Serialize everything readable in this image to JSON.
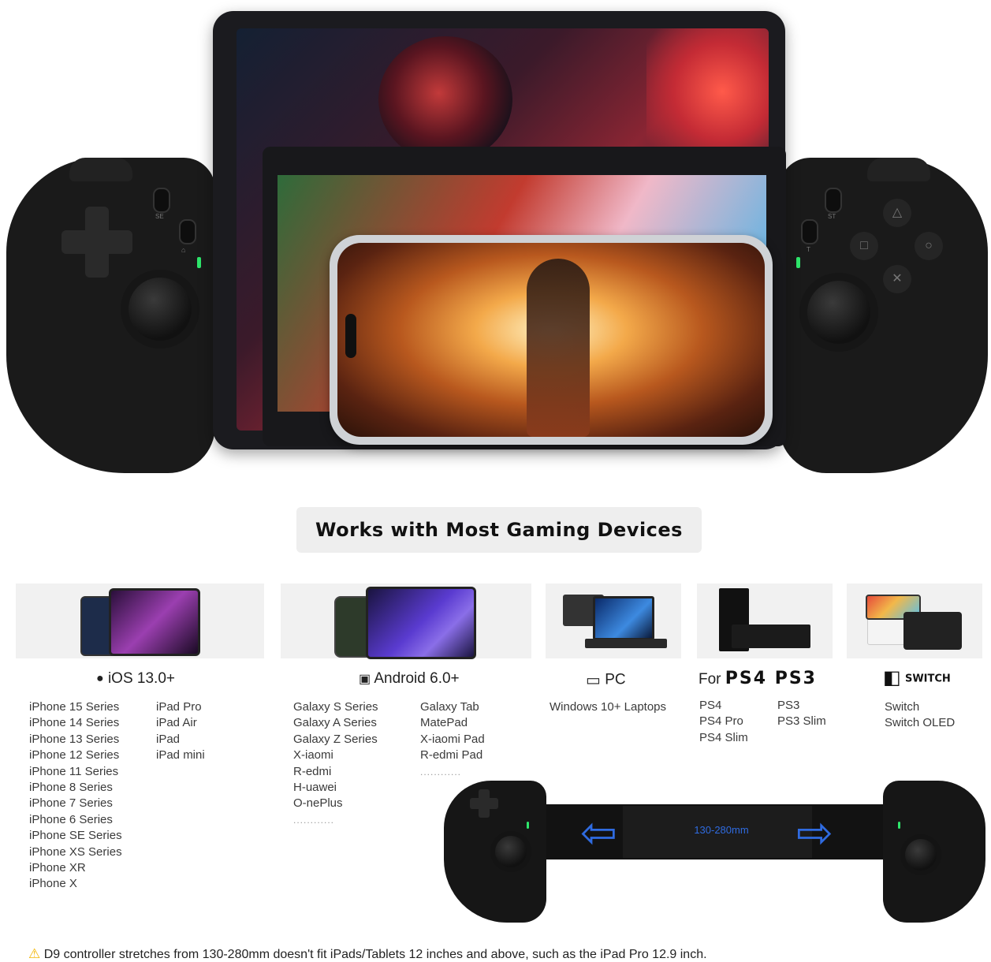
{
  "heading": "Works with Most Gaming Devices",
  "icons": {
    "ios": "apple-icon",
    "android": "android-icon",
    "pc": "pc-icon",
    "switch": "nintendo-switch-icon",
    "warning": "warning-icon"
  },
  "colors": {
    "accent_blue": "#2f6be0",
    "led_green": "#2ee66b",
    "warning_yellow": "#f2b400"
  },
  "ios": {
    "title": "iOS 13.0+",
    "col1": [
      "iPhone 15 Series",
      "iPhone 14 Series",
      "iPhone 13 Series",
      "iPhone 12 Series",
      "iPhone 11 Series",
      "iPhone 8 Series",
      "iPhone 7 Series",
      "iPhone 6 Series",
      "iPhone SE Series",
      "iPhone XS Series",
      "iPhone XR",
      "iPhone X"
    ],
    "col2": [
      "iPad Pro",
      "iPad Air",
      "iPad",
      "iPad mini"
    ]
  },
  "android": {
    "title": "Android 6.0+",
    "col1": [
      "Galaxy S Series",
      "Galaxy A Series",
      "Galaxy Z Series",
      "X-iaomi",
      "R-edmi",
      "H-uawei",
      "O-nePlus"
    ],
    "col1_more": "............",
    "col2": [
      "Galaxy Tab",
      "MatePad",
      "X-iaomi Pad",
      "R-edmi Pad"
    ],
    "col2_more": "............"
  },
  "pc": {
    "title": "PC",
    "subtitle": "Windows 10+ Laptops"
  },
  "ps": {
    "prefix": "For",
    "title": "PS4 PS3",
    "col1": [
      "PS4",
      "PS4 Pro",
      "PS4 Slim"
    ],
    "col2": [
      "PS3",
      "PS3 Slim"
    ]
  },
  "switch": {
    "title": "SWITCH",
    "items": [
      "Switch",
      "Switch OLED"
    ]
  },
  "controller": {
    "stretch_label": "130-280mm",
    "button_labels": {
      "select": "SE",
      "start": "ST",
      "turbo": "T",
      "home": "⌂"
    }
  },
  "warning": "D9 controller stretches from 130-280mm doesn't fit iPads/Tablets 12 inches and above, such as the iPad Pro 12.9 inch."
}
